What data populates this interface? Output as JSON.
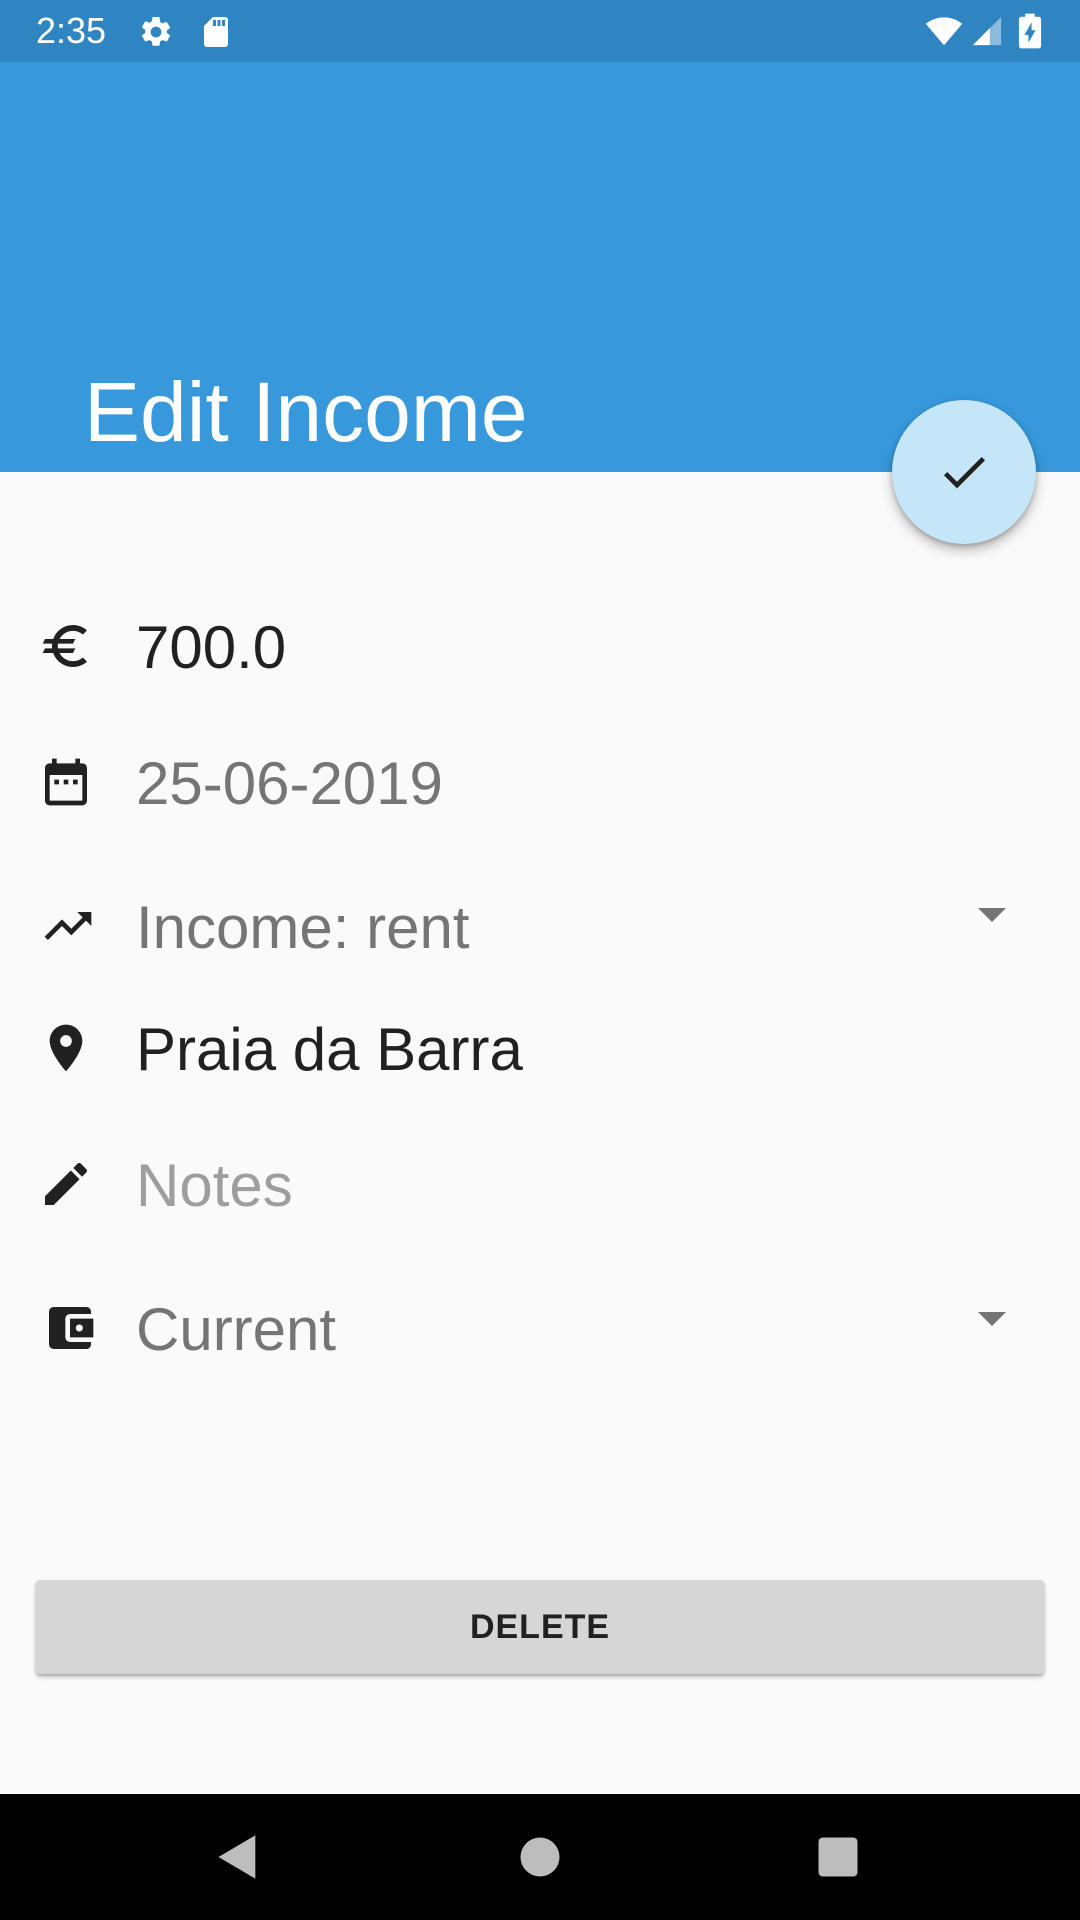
{
  "status_bar": {
    "time": "2:35",
    "left_icons": [
      "gear-icon",
      "sd-card-icon"
    ],
    "right_icons": [
      "wifi-icon",
      "cell-signal-icon",
      "battery-charging-icon"
    ]
  },
  "app_bar": {
    "title": "Edit Income",
    "color": "#3799db"
  },
  "fab": {
    "icon": "check-icon",
    "color": "#c5e5f8"
  },
  "form": {
    "amount": {
      "icon": "euro-icon",
      "value": "700.0"
    },
    "date": {
      "icon": "calendar-icon",
      "value": "25-06-2019"
    },
    "category": {
      "icon": "trending-up-icon",
      "value": "Income: rent"
    },
    "location": {
      "icon": "location-pin-icon",
      "value": "Praia da Barra"
    },
    "notes": {
      "icon": "pencil-icon",
      "placeholder": "Notes"
    },
    "account": {
      "icon": "wallet-icon",
      "value": "Current"
    }
  },
  "delete_button": {
    "label": "DELETE"
  },
  "nav_bar": {
    "icons": [
      "back-icon",
      "home-icon",
      "recents-icon"
    ]
  }
}
